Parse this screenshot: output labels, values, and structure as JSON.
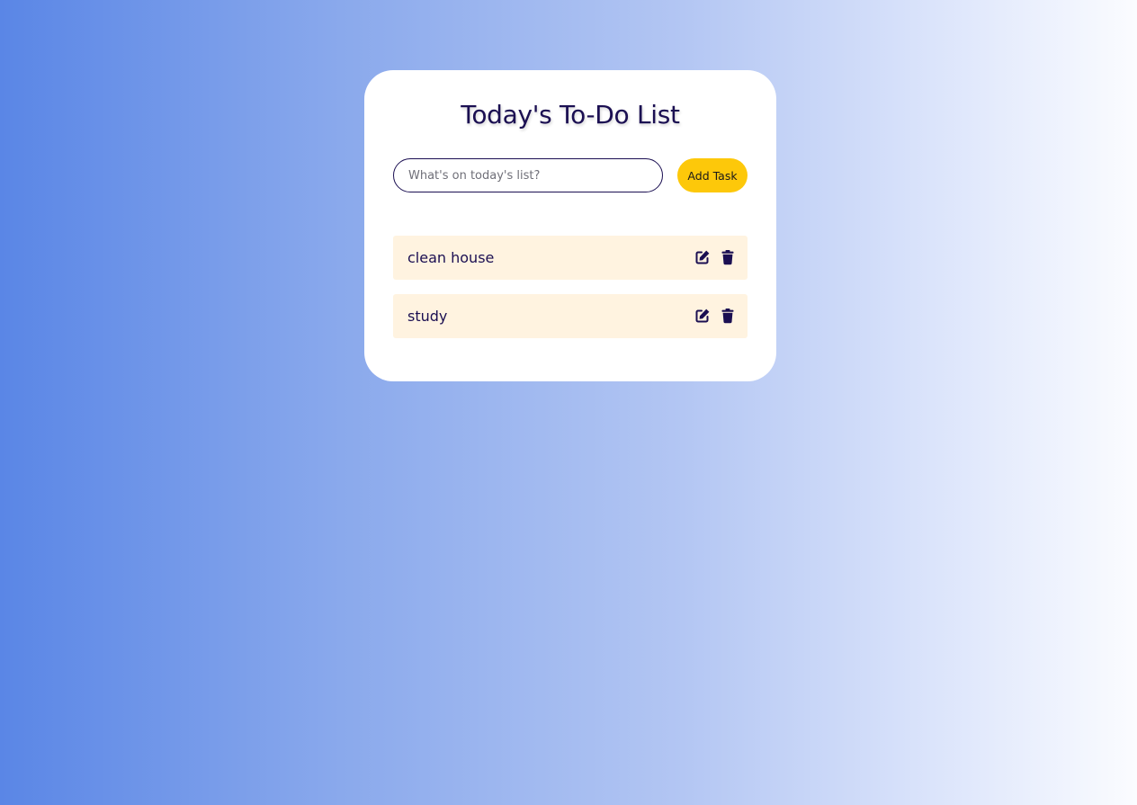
{
  "app": {
    "title": "Today's To-Do List"
  },
  "form": {
    "input_placeholder": "What's on today's list?",
    "input_value": "",
    "add_button_label": "Add Task"
  },
  "tasks": [
    {
      "label": "clean house",
      "edit_icon": "edit-icon",
      "delete_icon": "trash-icon"
    },
    {
      "label": "study",
      "edit_icon": "edit-icon",
      "delete_icon": "trash-icon"
    }
  ],
  "colors": {
    "accent": "#fdc80a",
    "text_primary": "#1b0f52",
    "task_background": "#fff3e0",
    "gradient_start": "#5a86e6",
    "gradient_end": "#fbfcff"
  }
}
